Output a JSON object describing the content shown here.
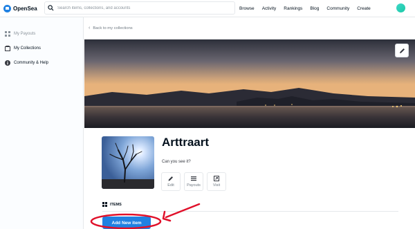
{
  "header": {
    "logo_text": "OpenSea",
    "search_placeholder": "Search items, collections, and accounts",
    "nav": [
      "Browse",
      "Activity",
      "Rankings",
      "Blog",
      "Community",
      "Create"
    ]
  },
  "sidebar": {
    "items": [
      {
        "label": "My Payouts",
        "icon": "grid-icon"
      },
      {
        "label": "My Collections",
        "icon": "collection-icon"
      },
      {
        "label": "Community & Help",
        "icon": "info-icon"
      }
    ]
  },
  "main": {
    "back_link": "Back to my collections",
    "collection_name": "Arttraart",
    "collection_description": "Can you see it?",
    "actions": [
      {
        "label": "Edit",
        "icon": "pencil-icon"
      },
      {
        "label": "Payouts",
        "icon": "list-icon"
      },
      {
        "label": "Visit",
        "icon": "external-icon"
      }
    ],
    "items_header": "ITEMS",
    "add_item_button": "Add New item"
  },
  "colors": {
    "accent": "#2081e2",
    "annotation": "#e0102a"
  }
}
